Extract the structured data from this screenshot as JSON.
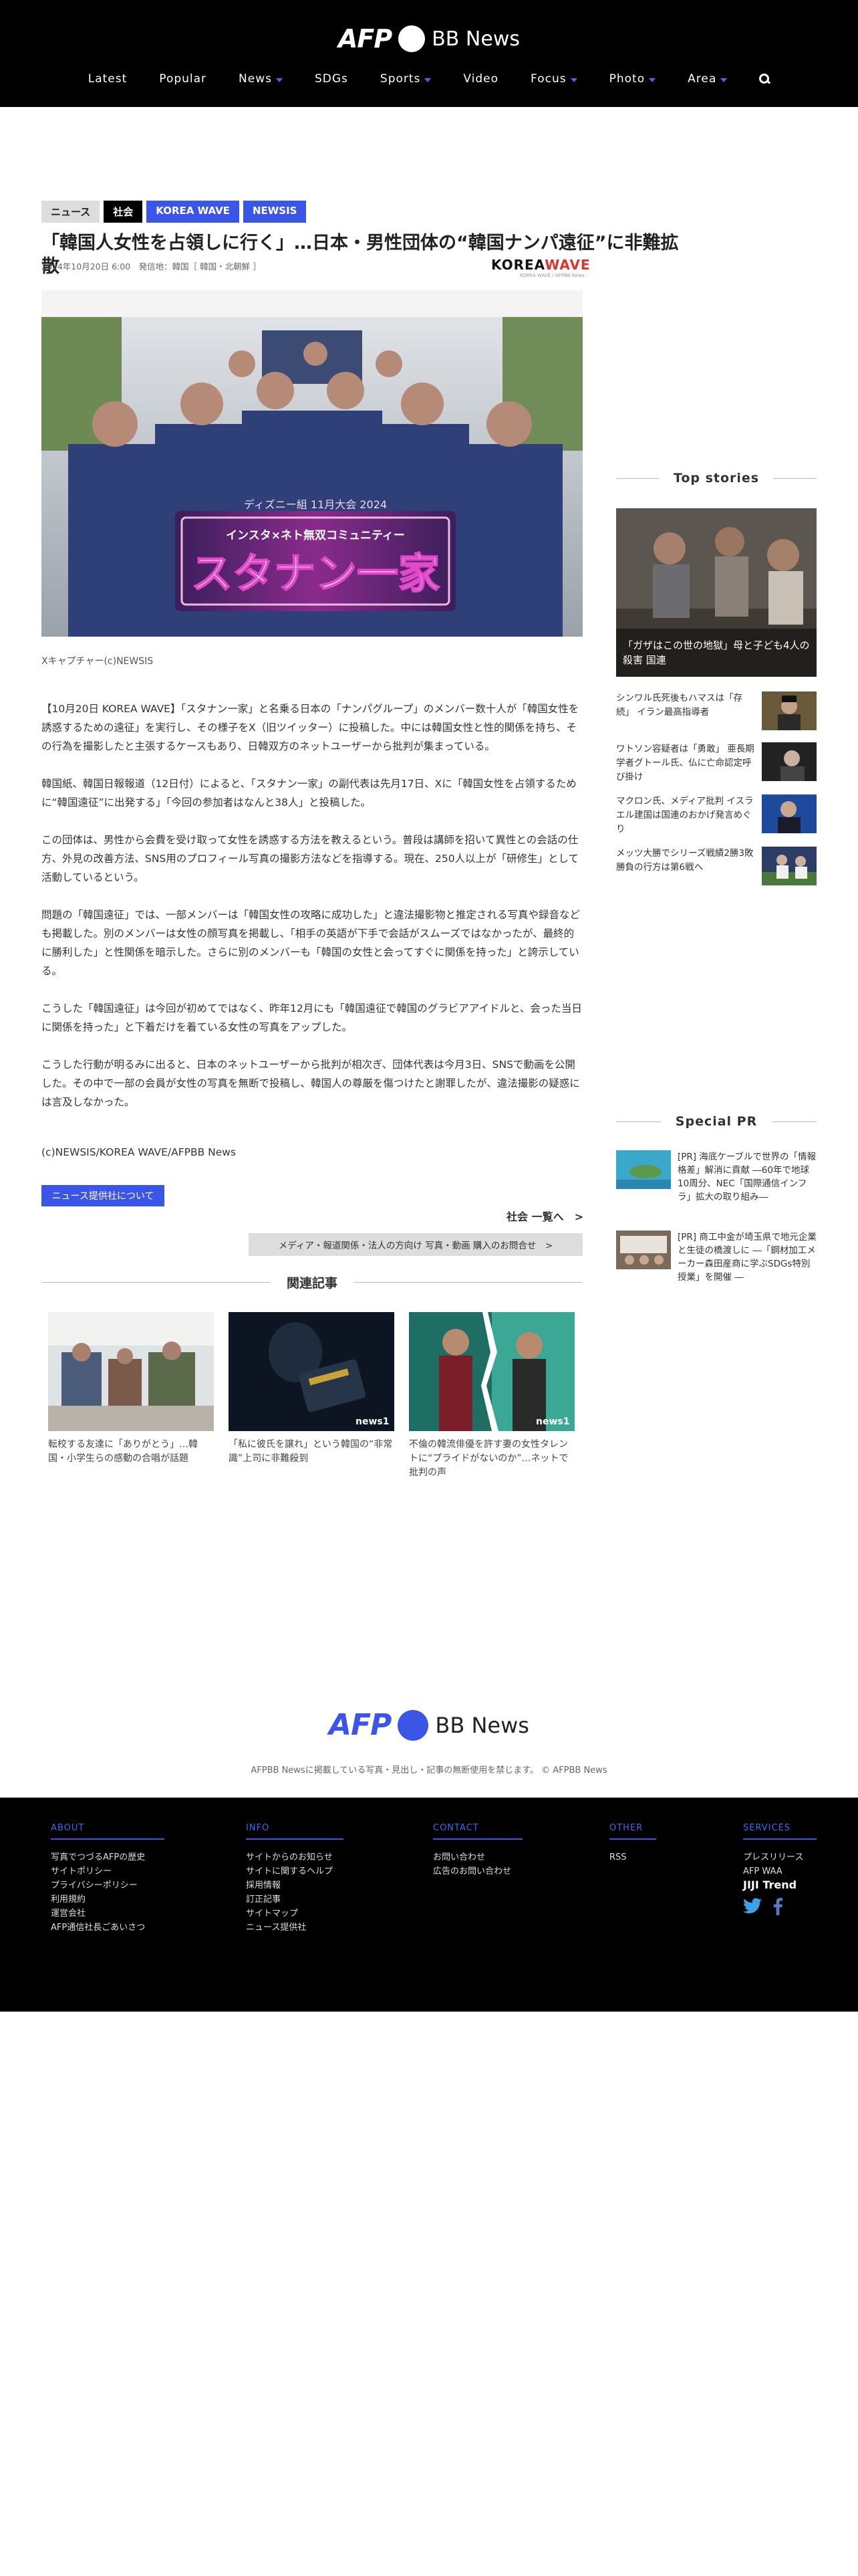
{
  "header": {
    "logo_afp": "AFP",
    "logo_bb": "BB News",
    "nav": [
      {
        "label": "Latest",
        "dropdown": false
      },
      {
        "label": "Popular",
        "dropdown": false
      },
      {
        "label": "News",
        "dropdown": true
      },
      {
        "label": "SDGs",
        "dropdown": false
      },
      {
        "label": "Sports",
        "dropdown": true
      },
      {
        "label": "Video",
        "dropdown": false
      },
      {
        "label": "Focus",
        "dropdown": true
      },
      {
        "label": "Photo",
        "dropdown": true
      },
      {
        "label": "Area",
        "dropdown": true
      }
    ],
    "search_icon": "search-icon"
  },
  "article": {
    "tags": [
      "ニュース",
      "社会",
      "KOREA WAVE",
      "NEWSIS"
    ],
    "title": "「韓国人女性を占領しに行く」…日本・男性団体の“韓国ナンパ遠征”に非難拡散",
    "meta": "2024年10月20日 6:00　発信地：韓国［ 韓国・北朝鮮 ］",
    "source_logo_a": "KOREA",
    "source_logo_b": "WAVE",
    "source_logo_sub": "KOREA WAVE / AFPBB News",
    "banner_small": "ディズニー組 11月大会 2024",
    "banner_sub": "インスタ×ネト無双コミュニティー",
    "banner_main": "スタナン一家",
    "caption": "Xキャプチャー(c)NEWSIS",
    "paragraphs": [
      "【10月20日 KOREA WAVE】「スタナン一家」と名乗る日本の「ナンパグループ」のメンバー数十人が「韓国女性を誘惑するための遠征」を実行し、その様子をX（旧ツイッター）に投稿した。中には韓国女性と性的関係を持ち、その行為を撮影したと主張するケースもあり、日韓双方のネットユーザーから批判が集まっている。",
      "韓国紙、韓国日報報道（12日付）によると、「スタナン一家」の副代表は先月17日、Xに「韓国女性を占領するために“韓国遠征”に出発する」「今回の参加者はなんと38人」と投稿した。",
      "この団体は、男性から会費を受け取って女性を誘惑する方法を教えるという。普段は講師を招いて異性との会話の仕方、外見の改善方法、SNS用のプロフィール写真の撮影方法などを指導する。現在、250人以上が「研修生」として活動しているという。",
      "問題の「韓国遠征」では、一部メンバーは「韓国女性の攻略に成功した」と違法撮影物と推定される写真や録音なども掲載した。別のメンバーは女性の顔写真を掲載し、「相手の英語が下手で会話がスムーズではなかったが、最終的に勝利した」と性関係を暗示した。さらに別のメンバーも「韓国の女性と会ってすぐに関係を持った」と誇示している。",
      "こうした「韓国遠征」は今回が初めてではなく、昨年12月にも「韓国遠征で韓国のグラビアアイドルと、会った当日に関係を持った」と下着だけを着ている女性の写真をアップした。",
      "こうした行動が明るみに出ると、日本のネットユーザーから批判が相次ぎ、団体代表は今月3日、SNSで動画を公開した。その中で一部の会員が女性の写真を無断で投稿し、韓国人の尊厳を傷つけたと謝罪したが、違法撮影の疑惑には言及しなかった。"
    ],
    "credit": "(c)NEWSIS/KOREA WAVE/AFPBB News",
    "provider_button": "ニュース提供社について",
    "all_link": "社会 一覧へ　>",
    "inquiry": "メディア・報道関係・法人の方向け 写真・動画 購入のお問合せ　>"
  },
  "related": {
    "heading": "関連記事",
    "items": [
      {
        "title": "転校する友達に「ありがとう」…韓国・小学生らの感動の合唱が話題"
      },
      {
        "title": "「私に彼氏を譲れ」という韓国の“非常識”上司に非難殺到"
      },
      {
        "title": "不倫の韓流俳優を許す妻の女性タレントに“プライドがないのか”…ネットで批判の声"
      }
    ],
    "watermark": "news1"
  },
  "sidebar": {
    "top_heading": "Top stories",
    "top_main": "「ガザはこの世の地獄」母と子ども4人の殺害 国連",
    "stories": [
      {
        "title": "シンワル氏死後もハマスは「存続」 イラン最高指導者"
      },
      {
        "title": "ワトソン容疑者は「勇敢」 亜長期学者グトール氏、仏に亡命認定呼び掛け"
      },
      {
        "title": "マクロン氏、メディア批判 イスラエル建国は国連のおかげ発言めぐり"
      },
      {
        "title": "メッツ大勝でシリーズ戦績2勝3敗 勝負の行方は第6戦へ"
      }
    ],
    "pr_heading": "Special PR",
    "pr_items": [
      {
        "title": "[PR] 海底ケーブルで世界の「情報格差」解消に貢献 ―60年で地球10周分、NEC「国際通信インフラ」拡大の取り組み―"
      },
      {
        "title": "[PR] 商工中金が埼玉県で地元企業と生徒の橋渡しに ―「鋼材加工メーカー森田産商に学ぶSDGs特別授業」を開催 ―"
      }
    ]
  },
  "footer": {
    "logo_afp": "AFP",
    "logo_bb": "BB News",
    "copyright": "AFPBB Newsに掲載している写真・見出し・記事の無断使用を禁じます。 © AFPBB News",
    "columns": [
      {
        "head": "ABOUT",
        "links": [
          "写真でつづるAFPの歴史",
          "サイトポリシー",
          "プライバシーポリシー",
          "利用規約",
          "運営会社",
          "AFP通信社長ごあいさつ"
        ]
      },
      {
        "head": "INFO",
        "links": [
          "サイトからのお知らせ",
          "サイトに関するヘルプ",
          "採用情報",
          "訂正記事",
          "サイトマップ",
          "ニュース提供社"
        ]
      },
      {
        "head": "CONTACT",
        "links": [
          "お問い合わせ",
          "広告のお問い合わせ"
        ]
      },
      {
        "head": "OTHER",
        "links": [
          "RSS"
        ]
      },
      {
        "head": "SERVICES",
        "links": [
          "プレスリリース",
          "AFP WAA"
        ]
      }
    ],
    "jiji": "JIJI Trend"
  }
}
